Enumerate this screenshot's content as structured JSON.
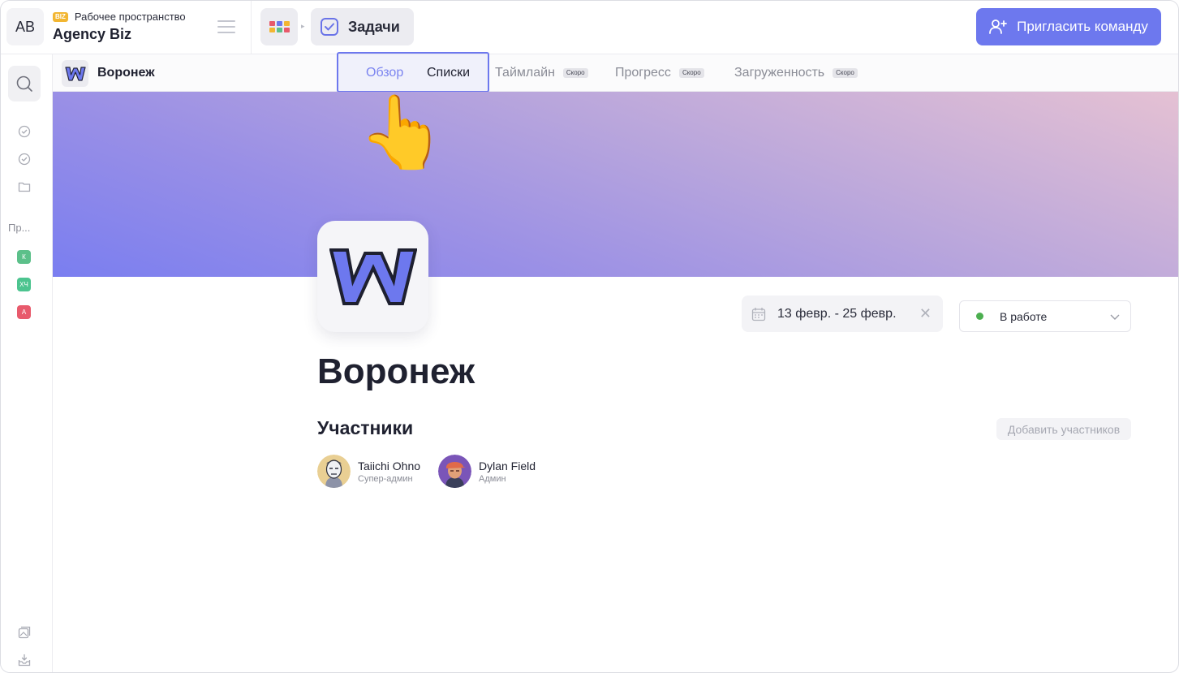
{
  "topbar": {
    "avatar_initials": "AB",
    "workspace_badge": "BIZ",
    "workspace_label": "Рабочее пространство",
    "workspace_name": "Agency Biz",
    "breadcrumb_current": "Задачи",
    "invite_label": "Пригласить команду"
  },
  "rail": {
    "section_label": "Пр...",
    "projects": [
      {
        "initials": "К",
        "color": "#5cc08a"
      },
      {
        "initials": "ХЧ",
        "color": "#4cc48f"
      },
      {
        "initials": "А",
        "color": "#e85a6c"
      }
    ]
  },
  "subnav": {
    "project_name": "Воронеж",
    "tabs": [
      {
        "label": "Обзор",
        "badge": ""
      },
      {
        "label": "Списки",
        "badge": ""
      },
      {
        "label": "Таймлайн",
        "badge": "Скоро"
      },
      {
        "label": "Прогресс",
        "badge": "Скоро"
      },
      {
        "label": "Загруженность",
        "badge": "Скоро"
      }
    ]
  },
  "project": {
    "title": "Воронеж",
    "date_range": "13 февр. - 25 февр.",
    "status": "В работе",
    "status_color": "#4caf50",
    "members_heading": "Участники",
    "add_members_label": "Добавить участников",
    "members": [
      {
        "name": "Taiichi Ohno",
        "role": "Супер-админ"
      },
      {
        "name": "Dylan Field",
        "role": "Админ"
      }
    ]
  },
  "colors": {
    "accent": "#6d78ee",
    "banner_start": "#7a7ef0",
    "banner_end": "#e5c1d3"
  }
}
